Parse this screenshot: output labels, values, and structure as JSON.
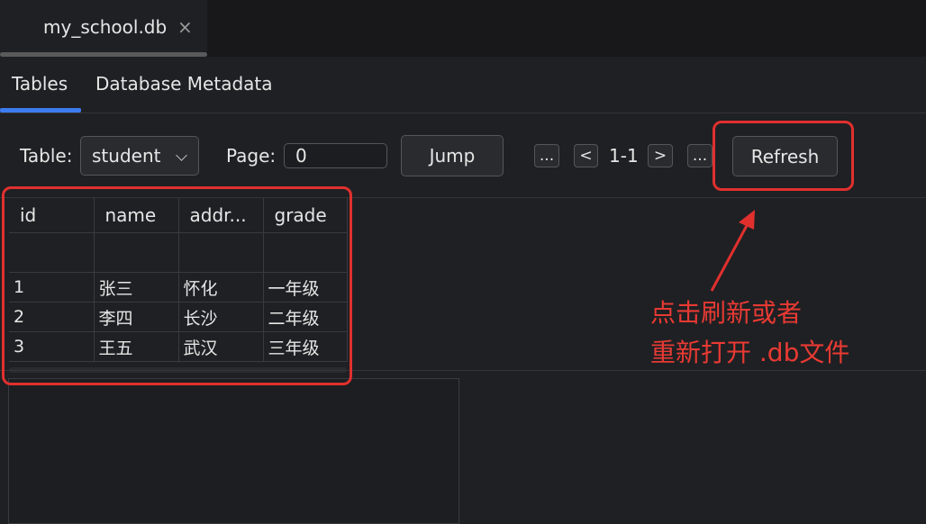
{
  "file_tab": {
    "title": "my_school.db",
    "close_glyph": "×"
  },
  "subtabs": [
    {
      "label": "Tables"
    },
    {
      "label": "Database Metadata"
    }
  ],
  "toolbar": {
    "table_label": "Table:",
    "table_value": "student",
    "page_label": "Page:",
    "page_value": "0",
    "jump_label": "Jump",
    "first_label": "...",
    "prev_label": "<",
    "range_text": "1-1",
    "next_label": ">",
    "last_label": "...",
    "refresh_label": "Refresh"
  },
  "grid": {
    "columns": [
      "id",
      "name",
      "addr...",
      "grade"
    ],
    "rows": [
      [
        "1",
        "张三",
        "怀化",
        "一年级"
      ],
      [
        "2",
        "李四",
        "长沙",
        "二年级"
      ],
      [
        "3",
        "王五",
        "武汉",
        "三年级"
      ]
    ]
  },
  "annotation": {
    "line1": "点击刷新或者",
    "line2": "重新打开 .db文件"
  },
  "colors": {
    "highlight": "#e0302e",
    "accent": "#3d7bf0",
    "background": "#1f2023"
  }
}
